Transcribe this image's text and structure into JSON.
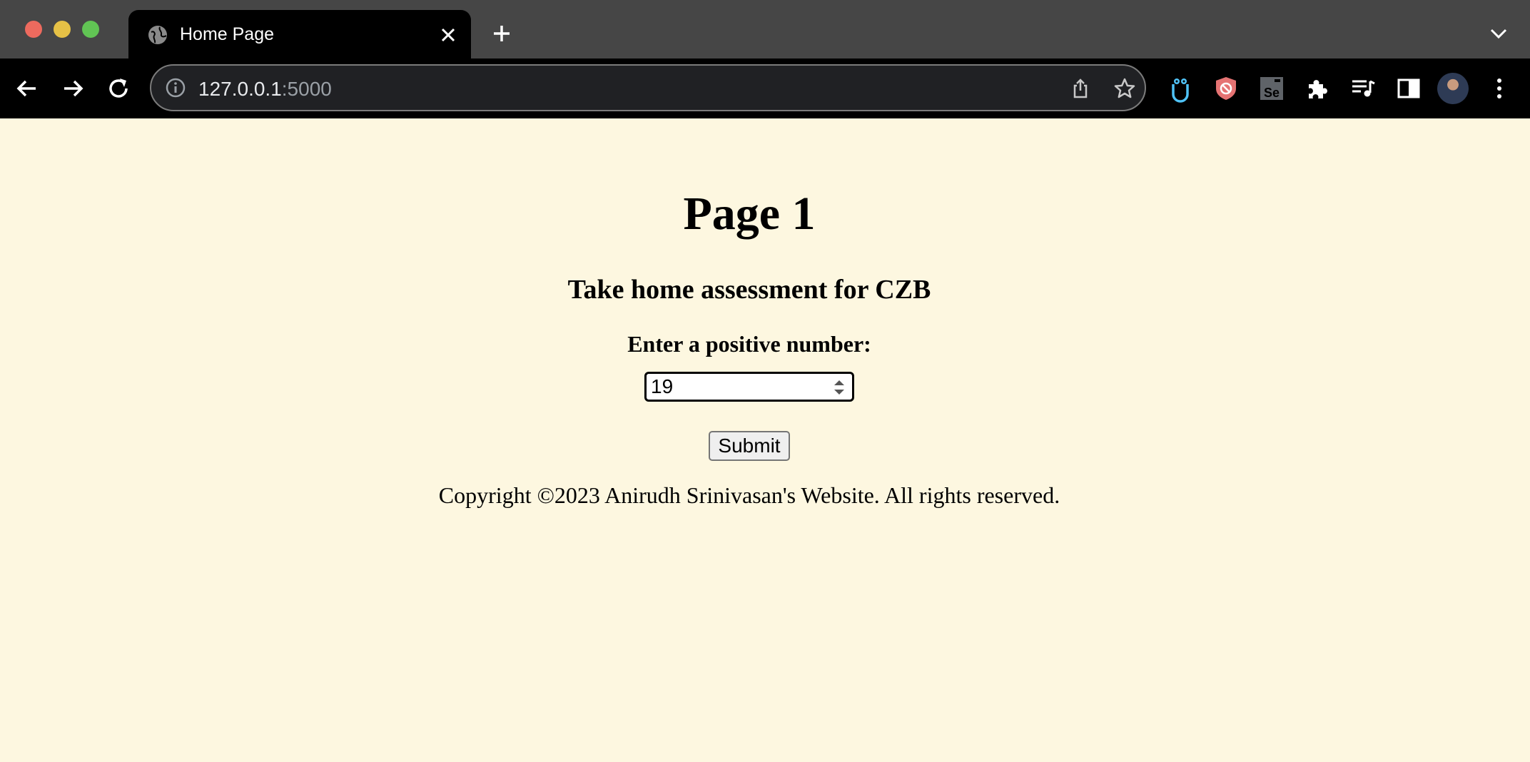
{
  "browser": {
    "tab": {
      "title": "Home Page"
    },
    "address_bar": {
      "host": "127.0.0.1",
      "port": ":5000"
    },
    "colors": {
      "tabstrip": "#464646",
      "toolbar": "#000000",
      "omnibox": "#202124"
    }
  },
  "page": {
    "heading": "Page 1",
    "subheading": "Take home assessment for CZB",
    "form": {
      "label": "Enter a positive number:",
      "number_value": "19",
      "submit_label": "Submit"
    },
    "footer": "Copyright ©2023 Anirudh Srinivasan's Website. All rights reserved.",
    "colors": {
      "background": "#fdf7e0"
    }
  },
  "icons": [
    "globe-icon",
    "close-icon",
    "plus-icon",
    "chevron-down-icon",
    "back-arrow-icon",
    "forward-arrow-icon",
    "reload-icon",
    "info-icon",
    "share-icon",
    "star-icon",
    "extension-owl-icon",
    "extension-shield-icon",
    "extension-selenium-icon",
    "puzzle-icon",
    "media-queue-icon",
    "side-panel-icon",
    "kebab-menu-icon"
  ]
}
